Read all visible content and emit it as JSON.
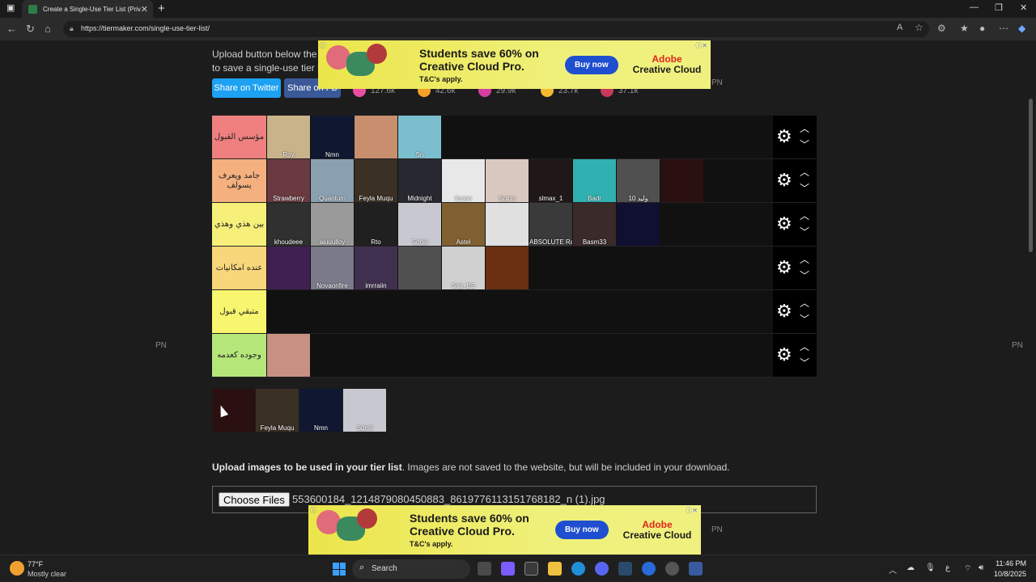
{
  "browser": {
    "tab_title": "Create a Single-Use Tier List (Priv",
    "url": "https://tiermaker.com/single-use-tier-list/",
    "new_tab": "+",
    "close_tab": "✕",
    "win_min": "—",
    "win_max": "❐",
    "win_close": "✕"
  },
  "page": {
    "intro_line1": "Upload button below the ... image. It is not possible",
    "intro_line2": "to save a single-use tier lis",
    "share_twitter": "Share on Twitter",
    "share_fb": "Share on FB",
    "reactions": [
      {
        "count": "127.6k",
        "color": "#e84fa0"
      },
      {
        "count": "42.6k",
        "color": "#f4a028"
      },
      {
        "count": "29.9k",
        "color": "#d63fa0"
      },
      {
        "count": "23.7k",
        "color": "#f5b82e"
      },
      {
        "count": "37.1k",
        "color": "#c83a5a"
      }
    ],
    "pn": "PN"
  },
  "ad": {
    "headline": "Students save 60% on Creative Cloud Pro.",
    "terms": "T&C's apply.",
    "button": "Buy now",
    "brand_top": "Adobe",
    "brand_bottom": "Creative Cloud"
  },
  "tiers": [
    {
      "label": "مؤسس القبول",
      "color": "#f08080",
      "items": [
        {
          "caption": "Roy",
          "bg": "#c9b38a"
        },
        {
          "caption": "Nmn",
          "bg": "#0f1830"
        },
        {
          "caption": "",
          "bg": "#c88f6f"
        },
        {
          "caption": "Sn",
          "bg": "#7bbfcf"
        }
      ]
    },
    {
      "label": "جامد ويعرف يسولف",
      "color": "#f4b07e",
      "items": [
        {
          "caption": "Strawberry",
          "bg": "#6a3a40"
        },
        {
          "caption": "Quantum",
          "bg": "#8aa0b0"
        },
        {
          "caption": "Feyla Muqu",
          "bg": "#3a3024"
        },
        {
          "caption": "Midnight",
          "bg": "#282830"
        },
        {
          "caption": "lisson",
          "bg": "#e8e8e8"
        },
        {
          "caption": "Spino",
          "bg": "#d8c8c0"
        },
        {
          "caption": "slmax_1",
          "bg": "#201818"
        },
        {
          "caption": "Badr",
          "bg": "#30b0b0"
        },
        {
          "caption": "10 وليد",
          "bg": "#505050"
        },
        {
          "caption": "",
          "bg": "#2a1010"
        }
      ]
    },
    {
      "label": "بين هذي وهذي",
      "color": "#f6f07a",
      "items": [
        {
          "caption": "khoudeee",
          "bg": "#303030"
        },
        {
          "caption": "aiuuulloy",
          "bg": "#9a9a9a"
        },
        {
          "caption": "Rto",
          "bg": "#202020"
        },
        {
          "caption": "Sdniil",
          "bg": "#c8c8d0"
        },
        {
          "caption": "Astel",
          "bg": "#806030"
        },
        {
          "caption": "",
          "bg": "#e0e0e0"
        },
        {
          "caption": "ABSOLUTE Rana",
          "bg": "#3a3a3a"
        },
        {
          "caption": "Basm33",
          "bg": "#3a2a2a"
        },
        {
          "caption": "",
          "bg": "#101030"
        }
      ]
    },
    {
      "label": "عنده امكانيات",
      "color": "#f8d67a",
      "items": [
        {
          "caption": "",
          "bg": "#402050"
        },
        {
          "caption": "Novaonfire",
          "bg": "#7a7a8a"
        },
        {
          "caption": "imrraiin",
          "bg": "#403050"
        },
        {
          "caption": "",
          "bg": "#505050"
        },
        {
          "caption": "Sati_BS",
          "bg": "#d0d0d0"
        },
        {
          "caption": "",
          "bg": "#6a3010"
        }
      ]
    },
    {
      "label": "متبقي قبول",
      "color": "#f8f56e",
      "items": []
    },
    {
      "label": "وجوده كعدمه",
      "color": "#b5e67a",
      "items": [
        {
          "caption": "",
          "bg": "#c89080"
        }
      ]
    }
  ],
  "pool": [
    {
      "caption": "",
      "bg": "#2a1010"
    },
    {
      "caption": "Feyla Muqu",
      "bg": "#3a3024"
    },
    {
      "caption": "Nmn",
      "bg": "#0f1830"
    },
    {
      "caption": "Sdniil",
      "bg": "#c8c8d0"
    }
  ],
  "upload": {
    "bold": "Upload images to be used in your tier list",
    "rest": ". Images are not saved to the website, but will be included in your download.",
    "button": "Choose Files",
    "file_name": "553600184_1214879080450883_8619776113151768182_n (1).jpg"
  },
  "taskbar": {
    "temp": "77°F",
    "weather": "Mostly clear",
    "search": "Search",
    "time": "11:46 PM",
    "date": "10/8/2025",
    "lang": "ع"
  }
}
